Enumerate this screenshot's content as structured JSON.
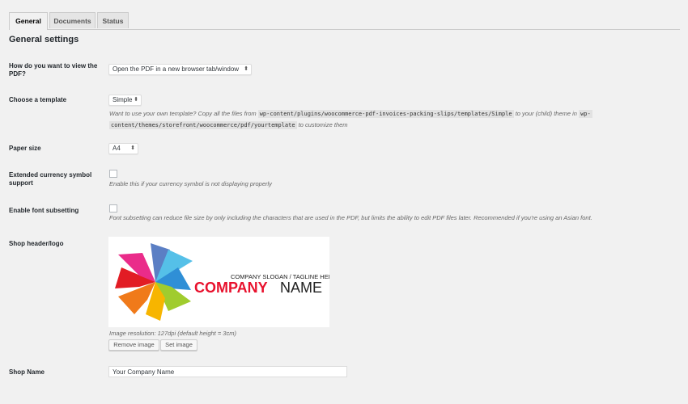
{
  "tabs": [
    {
      "label": "General",
      "active": true
    },
    {
      "label": "Documents",
      "active": false
    },
    {
      "label": "Status",
      "active": false
    }
  ],
  "section_title": "General settings",
  "view_pdf": {
    "label": "How do you want to view the PDF?",
    "value": "Open the PDF in a new browser tab/window"
  },
  "template": {
    "label": "Choose a template",
    "value": "Simple",
    "desc_1": "Want to use your own template? Copy all the files from",
    "code_1": "wp-content/plugins/woocommerce-pdf-invoices-packing-slips/templates/Simple",
    "desc_2": "to your (child) theme in",
    "code_2a": "wp-",
    "code_2b": "content/themes/storefront/woocommerce/pdf/yourtemplate",
    "desc_3": "to customize them"
  },
  "paper_size": {
    "label": "Paper size",
    "value": "A4"
  },
  "currency": {
    "label": "Extended currency symbol support",
    "desc": "Enable this if your currency symbol is not displaying properly"
  },
  "font_subset": {
    "label": "Enable font subsetting",
    "desc": "Font subsetting can reduce file size by only including the characters that are used in the PDF, but limits the ability to edit PDF files later. Recommended if you're using an Asian font."
  },
  "logo": {
    "label": "Shop header/logo",
    "slogan": "COMPANY SLOGAN / TAGLINE HERE",
    "company": "COMPANY",
    "name": "NAME",
    "resolution": "Image resolution: 127dpi (default height = 3cm)",
    "remove_label": "Remove image",
    "set_label": "Set image"
  },
  "shop_name": {
    "label": "Shop Name",
    "value": "Your Company Name"
  },
  "colors": {
    "company_red": "#e8112d",
    "accent": "#0073aa"
  }
}
